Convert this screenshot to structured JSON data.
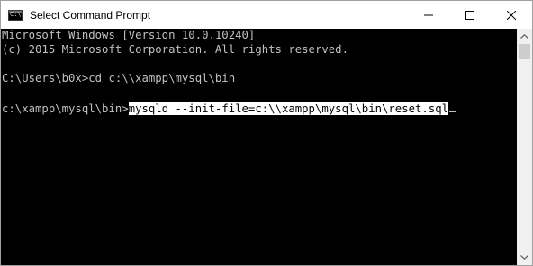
{
  "window": {
    "title": "Select Command Prompt",
    "icon": "cmd-icon",
    "icon_glyph": "C:\\"
  },
  "caption_buttons": {
    "minimize": "minimize-icon",
    "maximize": "maximize-icon",
    "close": "close-icon"
  },
  "console": {
    "lines": [
      "Microsoft Windows [Version 10.0.10240]",
      "(c) 2015 Microsoft Corporation. All rights reserved.",
      "",
      "C:\\Users\\b0x>cd c:\\\\xampp\\mysql\\bin",
      "",
      "c:\\xampp\\mysql\\bin>"
    ],
    "selected_command": "mysqld --init-file=c:\\\\xampp\\mysql\\bin\\reset.sql"
  },
  "colors": {
    "console_bg": "#000000",
    "console_text": "#c0c0c0",
    "selection_bg": "#ffffff",
    "selection_text": "#000000",
    "titlebar_bg": "#ffffff"
  }
}
